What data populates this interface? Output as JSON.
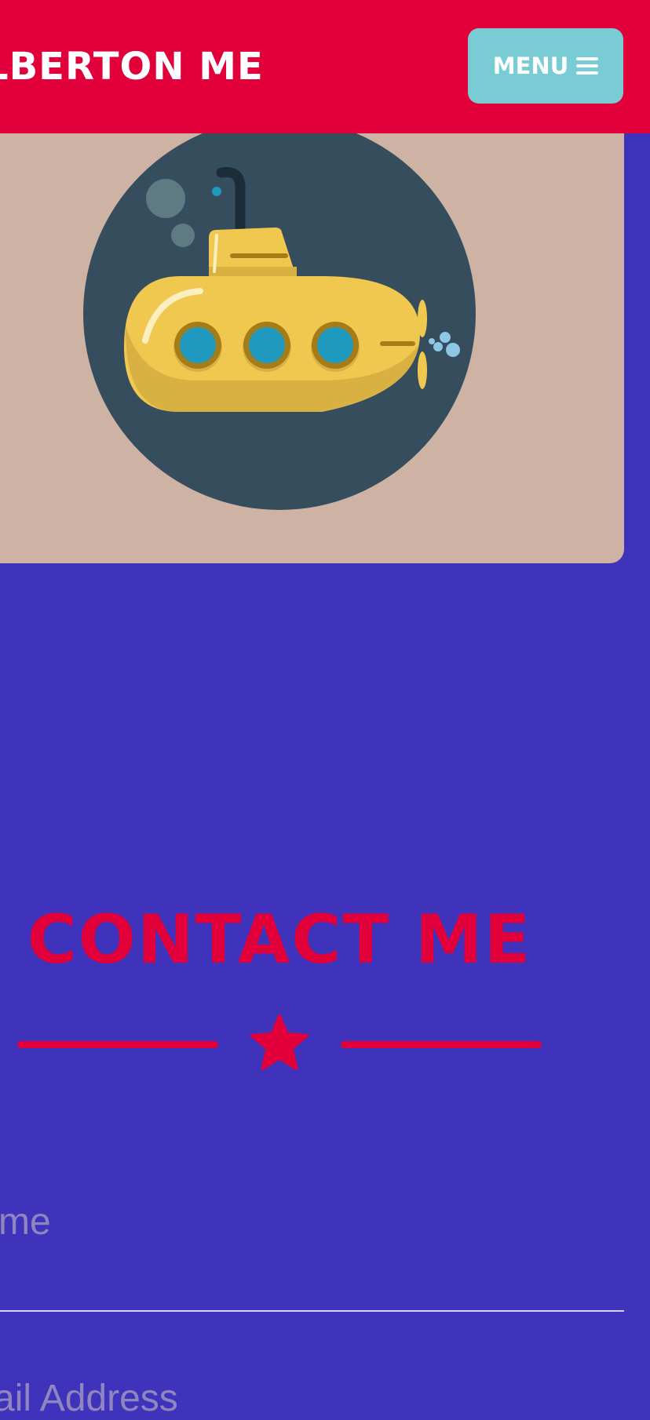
{
  "navbar": {
    "brand": "LBERTON ME",
    "menu_label": "MENU"
  },
  "hero": {
    "image_name": "submarine-illustration"
  },
  "contact": {
    "title": "CONTACT ME"
  },
  "form": {
    "name_label": "me",
    "email_label": "ail Address"
  },
  "colors": {
    "primary": "#e1003a",
    "background": "#4033bb",
    "menu_button": "#79ccd3",
    "card": "#ceb3a5"
  }
}
